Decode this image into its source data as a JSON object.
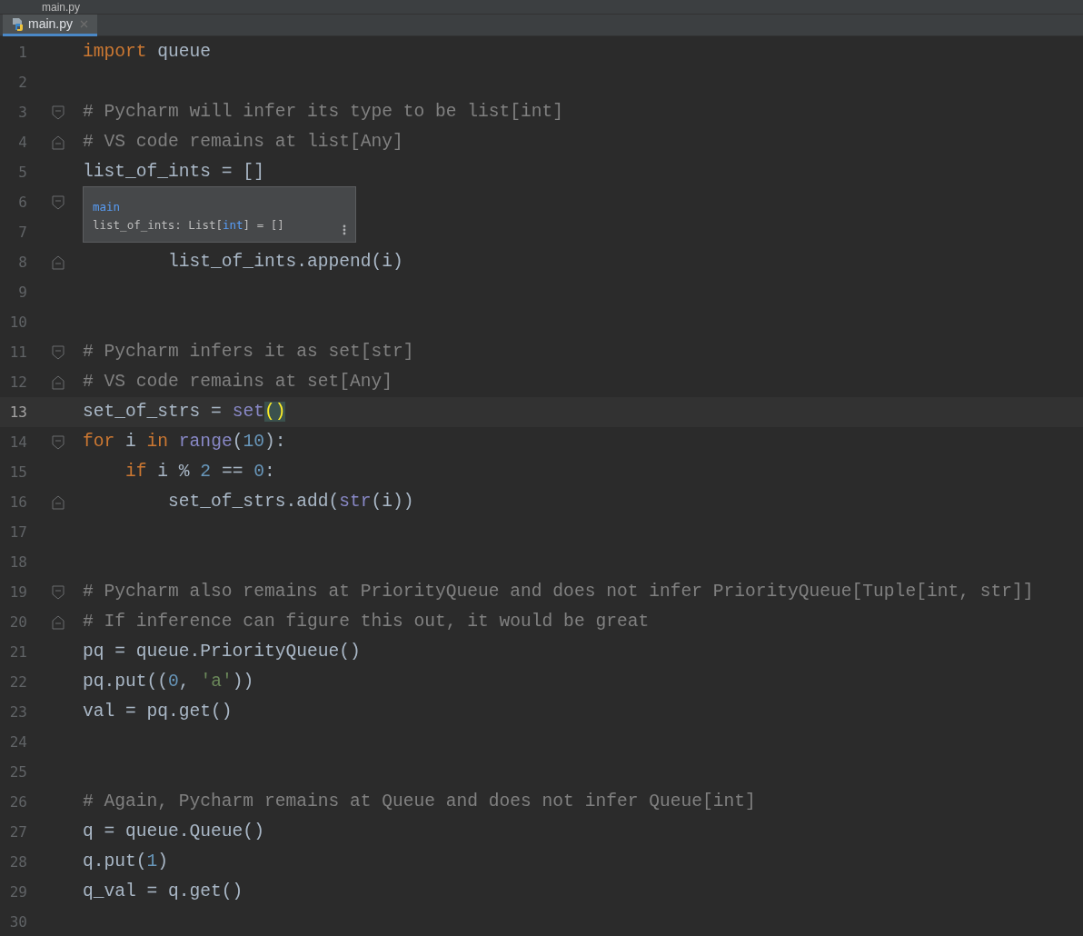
{
  "breadcrumb": {
    "file": "main.py"
  },
  "tabs": [
    {
      "label": "main.py",
      "selected": true
    }
  ],
  "editor": {
    "lines": [
      {
        "number": "1",
        "tokens": [
          {
            "kind": "keyword",
            "text": "import"
          },
          {
            "kind": "plain",
            "text": " queue"
          }
        ]
      },
      {
        "number": "2"
      },
      {
        "number": "3",
        "fold_start": true,
        "tokens": [
          {
            "kind": "comment",
            "text": "# Pycharm will infer its type to be list[int]"
          }
        ]
      },
      {
        "number": "4",
        "fold_end": true,
        "tokens": [
          {
            "kind": "comment",
            "text": "# VS code remains at list[Any]"
          }
        ]
      },
      {
        "number": "5",
        "tokens": [
          {
            "kind": "plain",
            "text": "list_of_ints = []"
          }
        ]
      },
      {
        "number": "6",
        "fold_start": true
      },
      {
        "number": "7"
      },
      {
        "number": "8",
        "fold_end": true,
        "tokens": [
          {
            "kind": "plain",
            "text": "        list_of_ints.append(i)"
          }
        ]
      },
      {
        "number": "9"
      },
      {
        "number": "10"
      },
      {
        "number": "11",
        "fold_start": true,
        "tokens": [
          {
            "kind": "comment",
            "text": "# Pycharm infers it as set[str]"
          }
        ]
      },
      {
        "number": "12",
        "fold_end": true,
        "tokens": [
          {
            "kind": "comment",
            "text": "# VS code remains at set[Any]"
          }
        ]
      },
      {
        "number": "13",
        "current": true,
        "tokens": [
          {
            "kind": "plain",
            "text": "set_of_strs = "
          },
          {
            "kind": "builtin",
            "text": "set"
          },
          {
            "kind": "brace-match",
            "text": "()"
          }
        ]
      },
      {
        "number": "14",
        "fold_start": true,
        "tokens": [
          {
            "kind": "keyword",
            "text": "for"
          },
          {
            "kind": "plain",
            "text": " i "
          },
          {
            "kind": "keyword",
            "text": "in"
          },
          {
            "kind": "builtin",
            "text": " range"
          },
          {
            "kind": "plain",
            "text": "("
          },
          {
            "kind": "number",
            "text": "10"
          },
          {
            "kind": "plain",
            "text": "):"
          }
        ]
      },
      {
        "number": "15",
        "tokens": [
          {
            "kind": "keyword",
            "text": "    if"
          },
          {
            "kind": "plain",
            "text": " i % "
          },
          {
            "kind": "number",
            "text": "2"
          },
          {
            "kind": "plain",
            "text": " == "
          },
          {
            "kind": "number",
            "text": "0"
          },
          {
            "kind": "plain",
            "text": ":"
          }
        ]
      },
      {
        "number": "16",
        "fold_end": true,
        "tokens": [
          {
            "kind": "plain",
            "text": "        set_of_strs.add("
          },
          {
            "kind": "builtin",
            "text": "str"
          },
          {
            "kind": "plain",
            "text": "(i))"
          }
        ]
      },
      {
        "number": "17"
      },
      {
        "number": "18"
      },
      {
        "number": "19",
        "fold_start": true,
        "tokens": [
          {
            "kind": "comment",
            "text": "# Pycharm also remains at PriorityQueue and does not infer PriorityQueue[Tuple[int, str]]"
          }
        ]
      },
      {
        "number": "20",
        "fold_end": true,
        "tokens": [
          {
            "kind": "comment",
            "text": "# If inference can figure this out, it would be great"
          }
        ]
      },
      {
        "number": "21",
        "tokens": [
          {
            "kind": "plain",
            "text": "pq = queue.PriorityQueue()"
          }
        ]
      },
      {
        "number": "22",
        "tokens": [
          {
            "kind": "plain",
            "text": "pq.put(("
          },
          {
            "kind": "number",
            "text": "0"
          },
          {
            "kind": "plain",
            "text": ", "
          },
          {
            "kind": "string",
            "text": "'a'"
          },
          {
            "kind": "plain",
            "text": "))"
          }
        ]
      },
      {
        "number": "23",
        "tokens": [
          {
            "kind": "plain",
            "text": "val = pq.get()"
          }
        ]
      },
      {
        "number": "24"
      },
      {
        "number": "25"
      },
      {
        "number": "26",
        "tokens": [
          {
            "kind": "comment",
            "text": "# Again, Pycharm remains at Queue and does not infer Queue[int]"
          }
        ]
      },
      {
        "number": "27",
        "tokens": [
          {
            "kind": "plain",
            "text": "q = queue.Queue()"
          }
        ]
      },
      {
        "number": "28",
        "tokens": [
          {
            "kind": "plain",
            "text": "q.put("
          },
          {
            "kind": "number",
            "text": "1"
          },
          {
            "kind": "plain",
            "text": ")"
          }
        ]
      },
      {
        "number": "29",
        "tokens": [
          {
            "kind": "plain",
            "text": "q_val = q.get()"
          }
        ]
      },
      {
        "number": "30"
      }
    ]
  },
  "tooltip": {
    "module": "main",
    "signature": [
      {
        "kind": "plain",
        "text": "list_of_ints: List["
      },
      {
        "kind": "type",
        "text": "int"
      },
      {
        "kind": "plain",
        "text": "] = []"
      }
    ]
  }
}
